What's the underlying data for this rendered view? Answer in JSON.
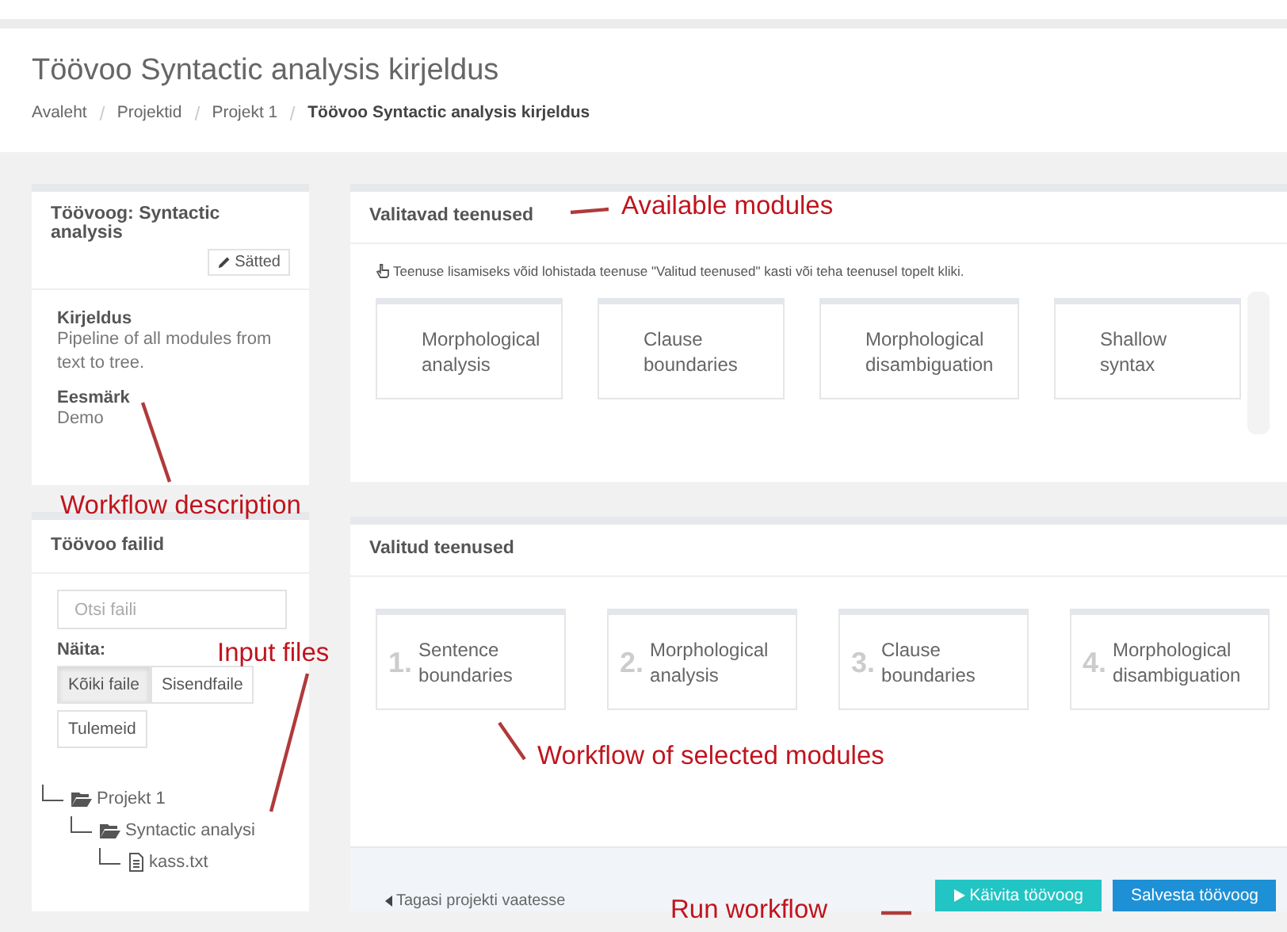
{
  "header": {
    "title": "Töövoo Syntactic analysis kirjeldus",
    "breadcrumbs": [
      {
        "label": "Avaleht",
        "current": false
      },
      {
        "label": "Projektid",
        "current": false
      },
      {
        "label": "Projekt 1",
        "current": false
      },
      {
        "label": "Töövoo Syntactic analysis kirjeldus",
        "current": true
      }
    ]
  },
  "workflow_panel": {
    "title": "Töövoog: Syntactic analysis",
    "settings_button": "Sätted",
    "fields": [
      {
        "label": "Kirjeldus",
        "value": "Pipeline of all modules from text to tree."
      },
      {
        "label": "Eesmärk",
        "value": "Demo"
      }
    ]
  },
  "files_panel": {
    "title": "Töövoo failid",
    "search": {
      "placeholder": "Otsi faili"
    },
    "filter_label": "Näita:",
    "filters": [
      {
        "label": "Kõiki faile",
        "selected": true
      },
      {
        "label": "Sisendfaile",
        "selected": false
      },
      {
        "label": "Tulemeid",
        "selected": false
      }
    ],
    "tree": [
      {
        "kind": "folder",
        "label": "Projekt 1",
        "children": [
          {
            "kind": "folder",
            "label": "Syntactic analysi",
            "children": [
              {
                "kind": "file",
                "label": "kass.txt"
              }
            ]
          }
        ]
      }
    ]
  },
  "available_modules": {
    "title": "Valitavad teenused",
    "hint": "Teenuse lisamiseks võid lohistada teenuse \"Valitud teenused\" kasti või teha teenusel topelt kliki.",
    "modules": [
      {
        "name": "Morphological analysis"
      },
      {
        "name": "Clause boundaries"
      },
      {
        "name": "Morphological disambiguation"
      },
      {
        "name": "Shallow syntax"
      }
    ]
  },
  "selected_modules": {
    "title": "Valitud teenused",
    "modules": [
      {
        "number": "1.",
        "name": "Sentence boundaries"
      },
      {
        "number": "2.",
        "name": "Morphological analysis"
      },
      {
        "number": "3.",
        "name": "Clause boundaries"
      },
      {
        "number": "4.",
        "name": "Morphological disambiguation"
      }
    ]
  },
  "footer": {
    "back_link": "Tagasi projekti vaatesse",
    "run_button": "Käivita töövoog",
    "save_button": "Salvesta töövoog"
  },
  "annotations": [
    {
      "text": "Available modules"
    },
    {
      "text": "Workflow description"
    },
    {
      "text": "Input files"
    },
    {
      "text": "Workflow of selected modules"
    },
    {
      "text": "Run workflow"
    }
  ]
}
